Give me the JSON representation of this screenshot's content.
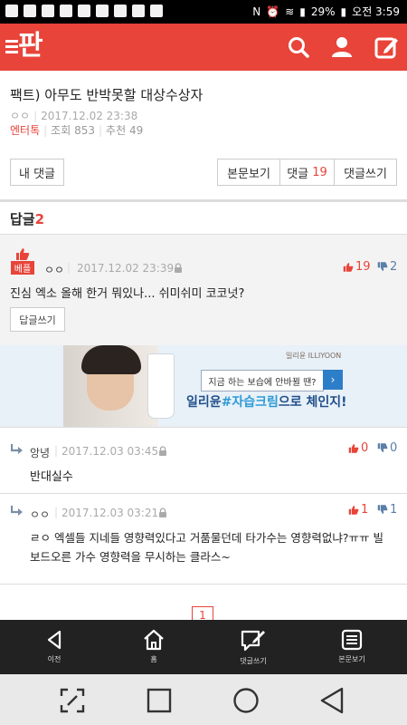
{
  "statusbar": {
    "battery": "29%",
    "time": "오전 3:59"
  },
  "appbar": {
    "logo": "판",
    "search_icon": "search-icon",
    "profile_icon": "profile-icon",
    "write_icon": "write-icon",
    "color": "#e8443a"
  },
  "article": {
    "title": "팩트) 아무도 반박못할 대상수상자",
    "author": "ㅇㅇ",
    "date": "2017.12.02 23:38",
    "category": "엔터톡",
    "views_label": "조회",
    "views": "853",
    "likes_label": "추천",
    "likes": "49"
  },
  "buttons": {
    "my_comments": "내 댓글",
    "view_article": "본문보기",
    "comments_label": "댓글",
    "comments_count": "19",
    "write_comment": "댓글쓰기"
  },
  "replies": {
    "heading": "답글",
    "count": "2"
  },
  "best_comment": {
    "badge": "베플",
    "author": "ㅇㅇ",
    "date": "2017.12.02 23:39",
    "up": "19",
    "down": "2",
    "text": "진심 엑소 올해 한거 뭐있나... 쉬미쉬미 코코넛?",
    "reply_button": "답글쓰기"
  },
  "ad": {
    "brand": "일리윤 ILLIYOON",
    "bubble": "지금 하는 보습에 안바뀔 땐?",
    "slogan_pre": "일리윤",
    "slogan_hl": "#자습크림",
    "slogan_post": "으로 체인지!"
  },
  "comments": [
    {
      "author": "앙녕",
      "date": "2017.12.03 03:45",
      "up": "0",
      "down": "0",
      "text": "반대실수"
    },
    {
      "author": "ㅇㅇ",
      "date": "2017.12.03 03:21",
      "up": "1",
      "down": "1",
      "text_line1": "ㄹㅇ 엑셀들 지네들 영향력있다고 거품물던데 타가수는 영향력없냐?ㅠㅠ 빌",
      "text_line2": "보드오른 가수 영향력을 무시하는 클라스~"
    }
  ],
  "pagination": {
    "current": "1"
  },
  "bottomnav": {
    "back": "이전",
    "home": "홈",
    "write": "댓글쓰기",
    "article": "본문보기"
  }
}
